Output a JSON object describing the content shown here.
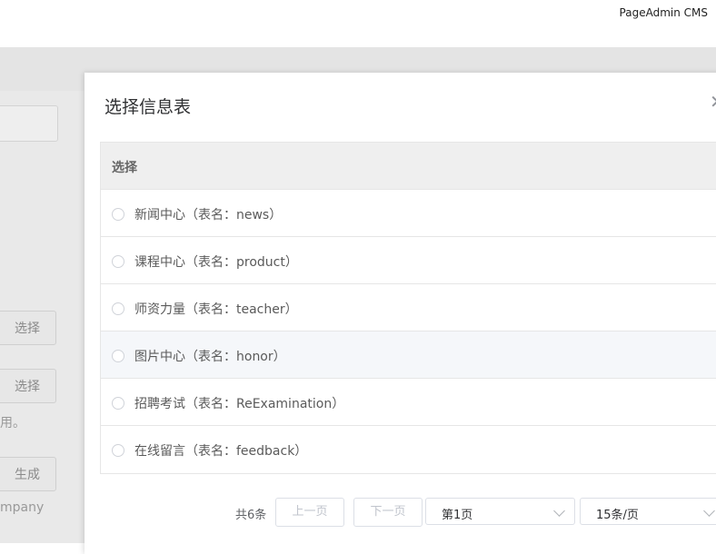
{
  "header": {
    "brand": "PageAdmin CMS"
  },
  "background": {
    "select_label_1": "选择",
    "select_label_2": "选择",
    "hint_text": "用。",
    "generate_label": "生成",
    "company_text": "mpany"
  },
  "modal": {
    "title": "选择信息表",
    "close_icon": "close-icon",
    "table": {
      "header": "选择",
      "rows": [
        {
          "label": "新闻中心（表名：news）",
          "selected": false
        },
        {
          "label": "课程中心（表名：product）",
          "selected": false
        },
        {
          "label": "师资力量（表名：teacher）",
          "selected": false
        },
        {
          "label": "图片中心（表名：honor）",
          "selected": false
        },
        {
          "label": "招聘考试（表名：ReExamination）",
          "selected": false
        },
        {
          "label": "在线留言（表名：feedback）",
          "selected": false
        }
      ]
    },
    "pagination": {
      "total": "共6条",
      "prev": "上一页",
      "next": "下一页",
      "page_select": "第1页",
      "size_select": "15条/页"
    }
  }
}
